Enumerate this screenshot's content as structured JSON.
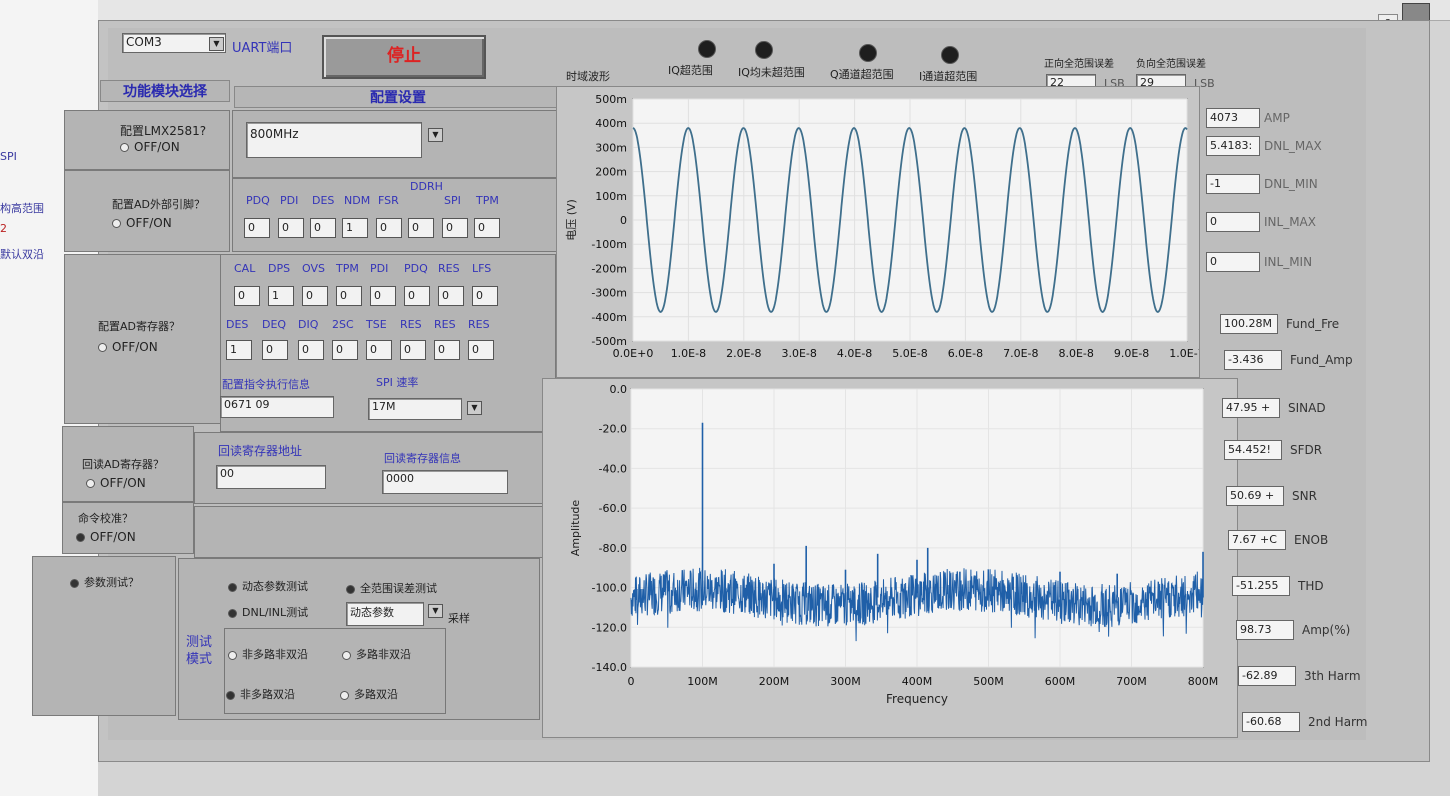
{
  "left_strip": {
    "items": [
      "SPI",
      "构高范围",
      "2",
      "默认双沿"
    ]
  },
  "header": {
    "com_port": "COM3",
    "uart_label": "UART端口",
    "stop_button": "停止",
    "time_wave_label": "时域波形",
    "leds": [
      "IQ超范围",
      "IQ均未超范围",
      "Q通道超范围",
      "I通道超范围"
    ],
    "pos_full_scale_label": "正向全范围误差",
    "neg_full_scale_label": "负向全范围误差",
    "pos_value": "22",
    "pos_unit": "LSB",
    "neg_value": "29",
    "neg_unit": "LSB"
  },
  "sidebar": {
    "module_title": "功能模块选择",
    "config_title": "配置设置",
    "lmx_label": "配置LMX2581?",
    "lmx_radio": "OFF/ON",
    "lmx_freq": "800MHz",
    "adpin_label": "配置AD外部引脚？",
    "adpin_radio": "OFF/ON",
    "pin_bits": [
      "PDQ",
      "PDI",
      "DES",
      "NDM",
      "FSR",
      "DDRH",
      "SPI",
      "TPM"
    ],
    "pin_values": [
      "0",
      "0",
      "0",
      "1",
      "0",
      "0",
      "0",
      "0"
    ],
    "adreg_label": "配置AD寄存器？",
    "adreg_radio": "OFF/ON",
    "reg_bits1": [
      "CAL",
      "DPS",
      "OVS",
      "TPM",
      "PDI",
      "PDQ",
      "RES",
      "LFS"
    ],
    "reg_values1": [
      "0",
      "1",
      "0",
      "0",
      "0",
      "0",
      "0",
      "0"
    ],
    "reg_bits2": [
      "DES",
      "DEQ",
      "DIQ",
      "2SC",
      "TSE",
      "RES",
      "RES",
      "RES"
    ],
    "reg_values2": [
      "1",
      "0",
      "0",
      "0",
      "0",
      "0",
      "0",
      "0"
    ],
    "exec_info_label": "配置指令执行信息",
    "exec_info_value": "0671 09",
    "spi_rate_label": "SPI 速率",
    "spi_rate_value": "17M",
    "readback_label": "回读AD寄存器？",
    "readback_radio": "OFF/ON",
    "rb_addr_label": "回读寄存器地址",
    "rb_addr_value": "00",
    "rb_info_label": "回读寄存器信息",
    "rb_info_value": "0000",
    "calib_label": "命令校准？",
    "calib_radio": "OFF/ON",
    "param_label": "参数测试？",
    "dyn_test": "动态参数测试",
    "full_range_test": "全范围误差测试",
    "dnl_test": "DNL/INL测试",
    "param_select": "动态参数",
    "sample_label": "采样",
    "mode_label": "测试模式",
    "modes": [
      "非多路非双沿",
      "多路非双沿",
      "非多路双沿",
      "多路双沿"
    ]
  },
  "right_panel": {
    "top": [
      {
        "value": "4073",
        "label": "AMP"
      },
      {
        "value": "5.4183:",
        "label": "DNL_MAX"
      },
      {
        "value": "-1",
        "label": "DNL_MIN"
      },
      {
        "value": "0",
        "label": "INL_MAX"
      },
      {
        "value": "0",
        "label": "INL_MIN"
      }
    ],
    "bottom": [
      {
        "value": "100.28M",
        "label": "Fund_Fre"
      },
      {
        "value": "-3.436",
        "label": "Fund_Amp"
      },
      {
        "value": "47.95 +",
        "label": "SINAD"
      },
      {
        "value": "54.452!",
        "label": "SFDR"
      },
      {
        "value": "50.69 +",
        "label": "SNR"
      },
      {
        "value": "7.67 +C",
        "label": "ENOB"
      },
      {
        "value": "-51.255",
        "label": "THD"
      },
      {
        "value": "98.73",
        "label": "Amp(%)"
      },
      {
        "value": "-62.89",
        "label": "3th Harm"
      },
      {
        "value": "-60.68",
        "label": "2nd Harm"
      }
    ]
  },
  "chart_data": [
    {
      "type": "line",
      "title": "",
      "xlabel": "",
      "ylabel": "电压 (V)",
      "xlim": [
        0,
        1e-07
      ],
      "ylim": [
        -0.5,
        0.5
      ],
      "x_tick_labels": [
        "0.0E+0",
        "1.0E-8",
        "2.0E-8",
        "3.0E-8",
        "4.0E-8",
        "5.0E-8",
        "6.0E-8",
        "7.0E-8",
        "8.0E-8",
        "9.0E-8",
        "1.0E-7"
      ],
      "y_tick_labels": [
        "500m",
        "400m",
        "300m",
        "200m",
        "100m",
        "0",
        "-100m",
        "-200m",
        "-300m",
        "-400m",
        "-500m"
      ],
      "series": [
        {
          "frequency_hz": 100280000.0,
          "amplitude": 0.38,
          "phase_start": "peak"
        }
      ],
      "colors": {
        "line": "#3f6f8c",
        "plot_bg": "#f4f4f4"
      }
    },
    {
      "type": "line",
      "title": "",
      "xlabel": "Frequency",
      "ylabel": "Amplitude",
      "xlim": [
        0,
        800
      ],
      "ylim": [
        -140,
        0
      ],
      "x_tick_labels": [
        "0",
        "100M",
        "200M",
        "300M",
        "400M",
        "500M",
        "600M",
        "700M",
        "800M"
      ],
      "y_tick_labels": [
        "0.0",
        "-20.0",
        "-40.0",
        "-60.0",
        "-80.0",
        "-100.0",
        "-120.0",
        "-140.0"
      ],
      "noise_floor": -105,
      "spikes": [
        {
          "x": 100,
          "y": -17
        },
        {
          "x": 200,
          "y": -88
        },
        {
          "x": 245,
          "y": -79
        },
        {
          "x": 300,
          "y": -91
        },
        {
          "x": 345,
          "y": -83
        },
        {
          "x": 400,
          "y": -86
        },
        {
          "x": 415,
          "y": -80
        },
        {
          "x": 460,
          "y": -92
        },
        {
          "x": 600,
          "y": -92
        },
        {
          "x": 680,
          "y": -93
        },
        {
          "x": 800,
          "y": -82
        }
      ],
      "colors": {
        "line": "#1f5fa8",
        "plot_bg": "#f4f4f4"
      }
    }
  ]
}
